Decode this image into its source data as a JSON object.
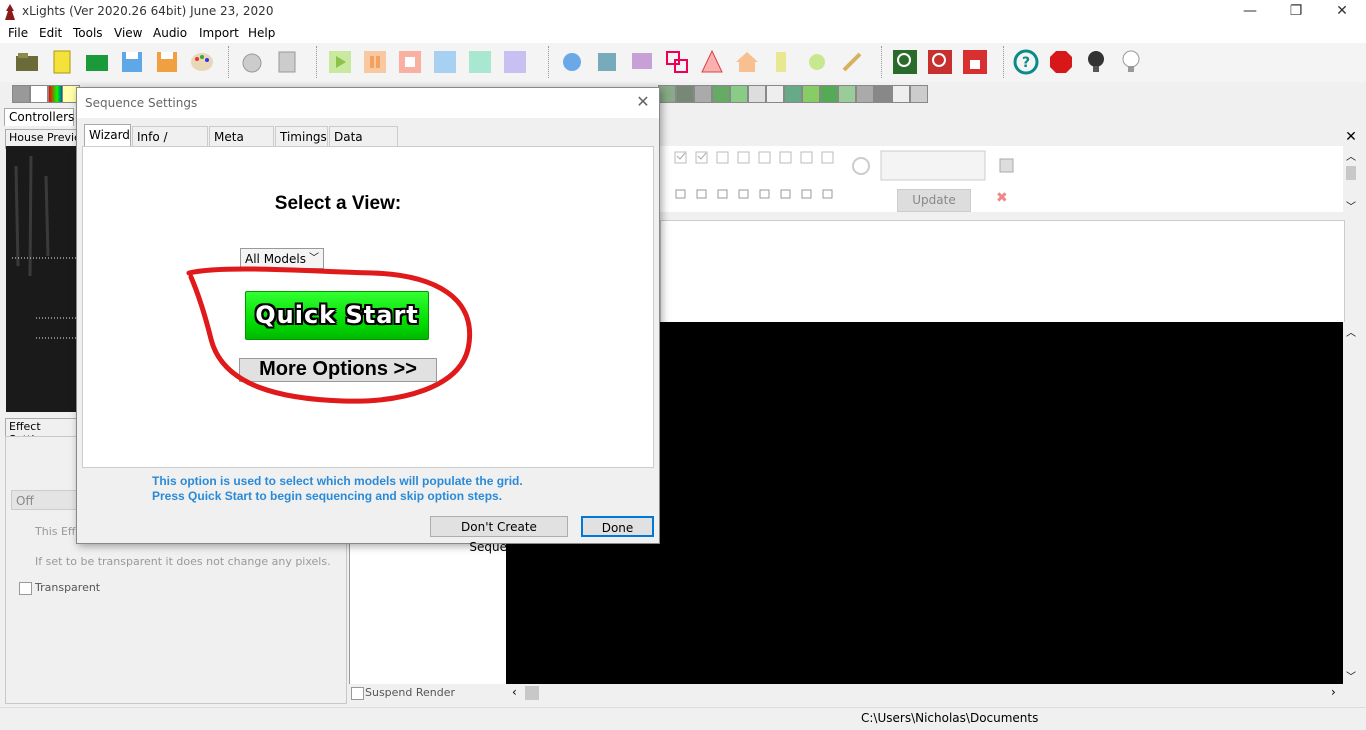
{
  "window": {
    "title": "xLights (Ver 2020.26 64bit) June 23, 2020",
    "minimize_glyph": "—",
    "restore_glyph": "❐",
    "close_glyph": "✕"
  },
  "menu": [
    "File",
    "Edit",
    "Tools",
    "View",
    "Audio",
    "Import",
    "Help"
  ],
  "toolbar": {
    "icons": [
      "open-folder-icon",
      "new-sequence-icon",
      "open-sequence-icon",
      "save-icon",
      "save-as-icon",
      "palette-icon",
      "render-timer-icon",
      "render-calc-icon",
      "play-icon",
      "pause-icon",
      "stop-icon",
      "first-frame-icon",
      "last-frame-icon",
      "replay-icon",
      "settings-icon",
      "settings-effects-icon",
      "settings-display-icon",
      "layout-icon",
      "tree-icon",
      "house-icon",
      "model-icon",
      "sparkle-icon",
      "wand-icon",
      "zoom-in-icon",
      "zoom-out-icon",
      "lock-icon",
      "help-icon",
      "stop-sign-icon",
      "bulb-off-icon",
      "bulb-on-icon"
    ]
  },
  "left": {
    "controllers_tab": "Controllers",
    "house_preview_title": "House Previe",
    "effect_settings_title": "Effect Settings",
    "effect_select_value": "Off",
    "effect_desc_1": "This Effe",
    "effect_desc_2": "If set to be transparent it does not change any pixels.",
    "transparent_label": "Transparent"
  },
  "right": {
    "close_glyph": "✕",
    "update_label": "Update",
    "suspend_render_label": "Suspend Render"
  },
  "status": {
    "path": "C:\\Users\\Nicholas\\Documents"
  },
  "dialog": {
    "title": "Sequence Settings",
    "close_glyph": "✕",
    "tabs": [
      "Wizard",
      "Info / Media",
      "Meta Data",
      "Timings",
      "Data Layers"
    ],
    "active_tab": "Wizard",
    "select_view_label": "Select a View:",
    "view_select_value": "All Models",
    "quick_start_label": "Quick  Start",
    "more_options_label": "More Options >>",
    "help_line_1": "This option is used to select which models will populate the grid.",
    "help_line_2": "Press Quick Start to begin sequencing and skip option steps.",
    "dont_create_label": "Don't Create Sequence",
    "done_label": "Done",
    "annotation_color": "#e0191b",
    "quick_start_color": "#18e818",
    "help_text_color": "#2a8ad8"
  }
}
